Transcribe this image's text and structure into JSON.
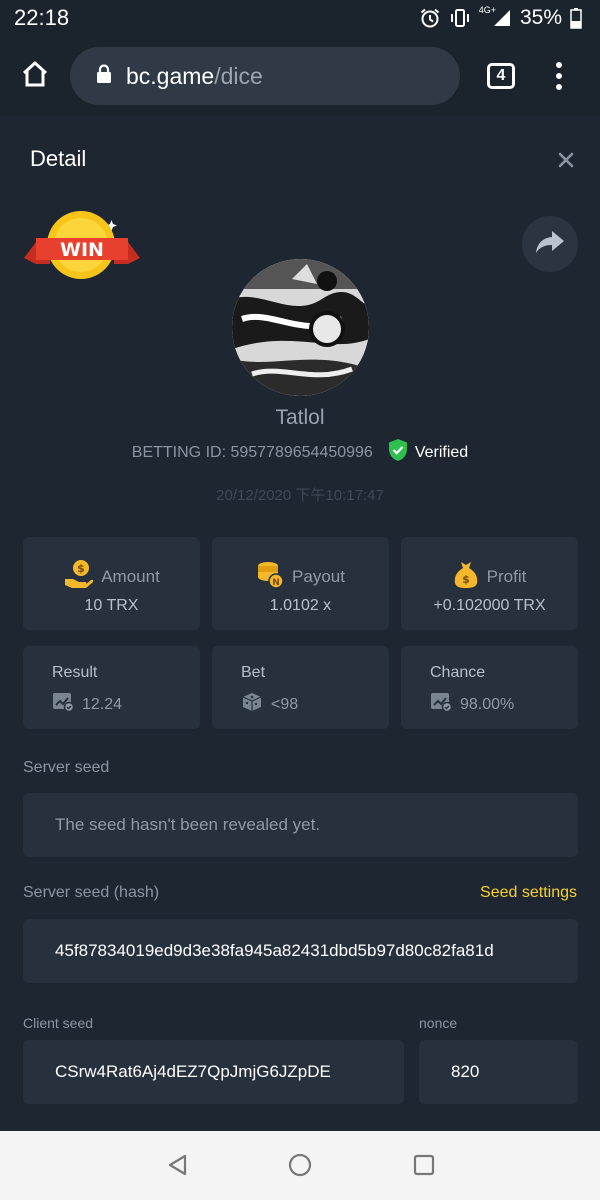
{
  "status_bar": {
    "time": "22:18",
    "network": "4G+",
    "battery": "35%"
  },
  "browser": {
    "url_host": "bc.game",
    "url_path": "/dice",
    "tab_count": "4"
  },
  "detail": {
    "title": "Detail",
    "badge": "WIN",
    "username": "Tatlol",
    "betting_id": "BETTING ID: 5957789654450996",
    "verified": "Verified",
    "timestamp": "20/12/2020 下午10:17:47"
  },
  "stats": {
    "amount": {
      "label": "Amount",
      "value": "10 TRX"
    },
    "payout": {
      "label": "Payout",
      "value": "1.0102 x"
    },
    "profit": {
      "label": "Profit",
      "value": "+0.102000 TRX"
    },
    "result": {
      "label": "Result",
      "value": "12.24"
    },
    "bet": {
      "label": "Bet",
      "value": "<98"
    },
    "chance": {
      "label": "Chance",
      "value": "98.00%"
    }
  },
  "seeds": {
    "server_seed_label": "Server seed",
    "server_seed_value": "The seed hasn't been revealed yet.",
    "server_hash_label": "Server seed (hash)",
    "seed_settings": "Seed settings",
    "server_hash_value": "45f87834019ed9d3e38fa945a82431dbd5b97d80c82fa81d",
    "client_seed_label": "Client seed",
    "client_seed_value": "CSrw4Rat6Aj4dEZ7QpJmjG6JZpDE",
    "nonce_label": "nonce",
    "nonce_value": "820"
  },
  "colors": {
    "background": "#1e2631",
    "card": "#27313d",
    "accent_yellow": "#f5d22a",
    "verified_green": "#2fbf4f"
  },
  "icons": [
    "home-icon",
    "lock-icon",
    "close-icon",
    "share-icon",
    "amount-icon",
    "payout-icon",
    "profit-icon",
    "result-icon",
    "dice-icon",
    "chance-icon",
    "back-icon",
    "home-circle-icon",
    "recents-icon"
  ]
}
